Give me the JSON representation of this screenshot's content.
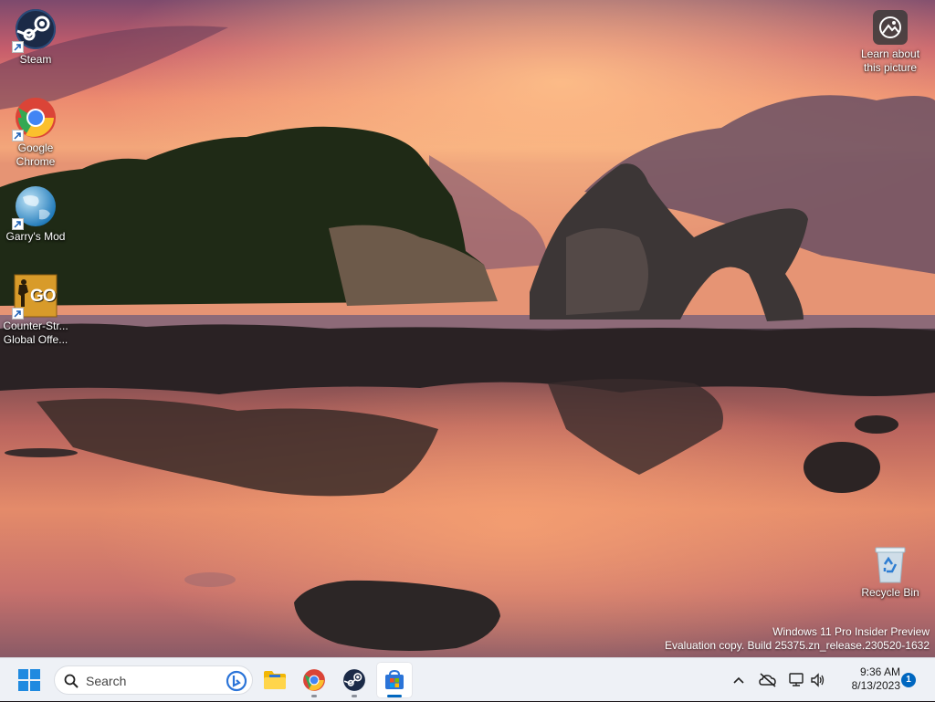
{
  "desktop": {
    "icons": [
      {
        "label": "Steam",
        "icon": "steam-icon"
      },
      {
        "label": "Google\nChrome",
        "icon": "chrome-icon"
      },
      {
        "label": "Garry's Mod",
        "icon": "garrys-mod-icon"
      },
      {
        "label": "Counter-Str...\nGlobal Offe...",
        "icon": "csgo-icon"
      },
      {
        "label": "Learn about\nthis picture",
        "icon": "learn-about-picture-icon"
      },
      {
        "label": "Recycle Bin",
        "icon": "recycle-bin-icon"
      }
    ],
    "csgo_badge": "GO",
    "watermark": {
      "line1": "Windows 11 Pro Insider Preview",
      "line2": "Evaluation copy. Build 25375.zn_release.230520-1632"
    }
  },
  "taskbar": {
    "search_placeholder": "Search",
    "clock": {
      "time": "9:36 AM",
      "date": "8/13/2023"
    },
    "notification_count": "1",
    "apps": [
      "file-explorer-icon",
      "chrome-icon",
      "steam-icon",
      "microsoft-store-icon"
    ],
    "accent": "#0067c0"
  }
}
